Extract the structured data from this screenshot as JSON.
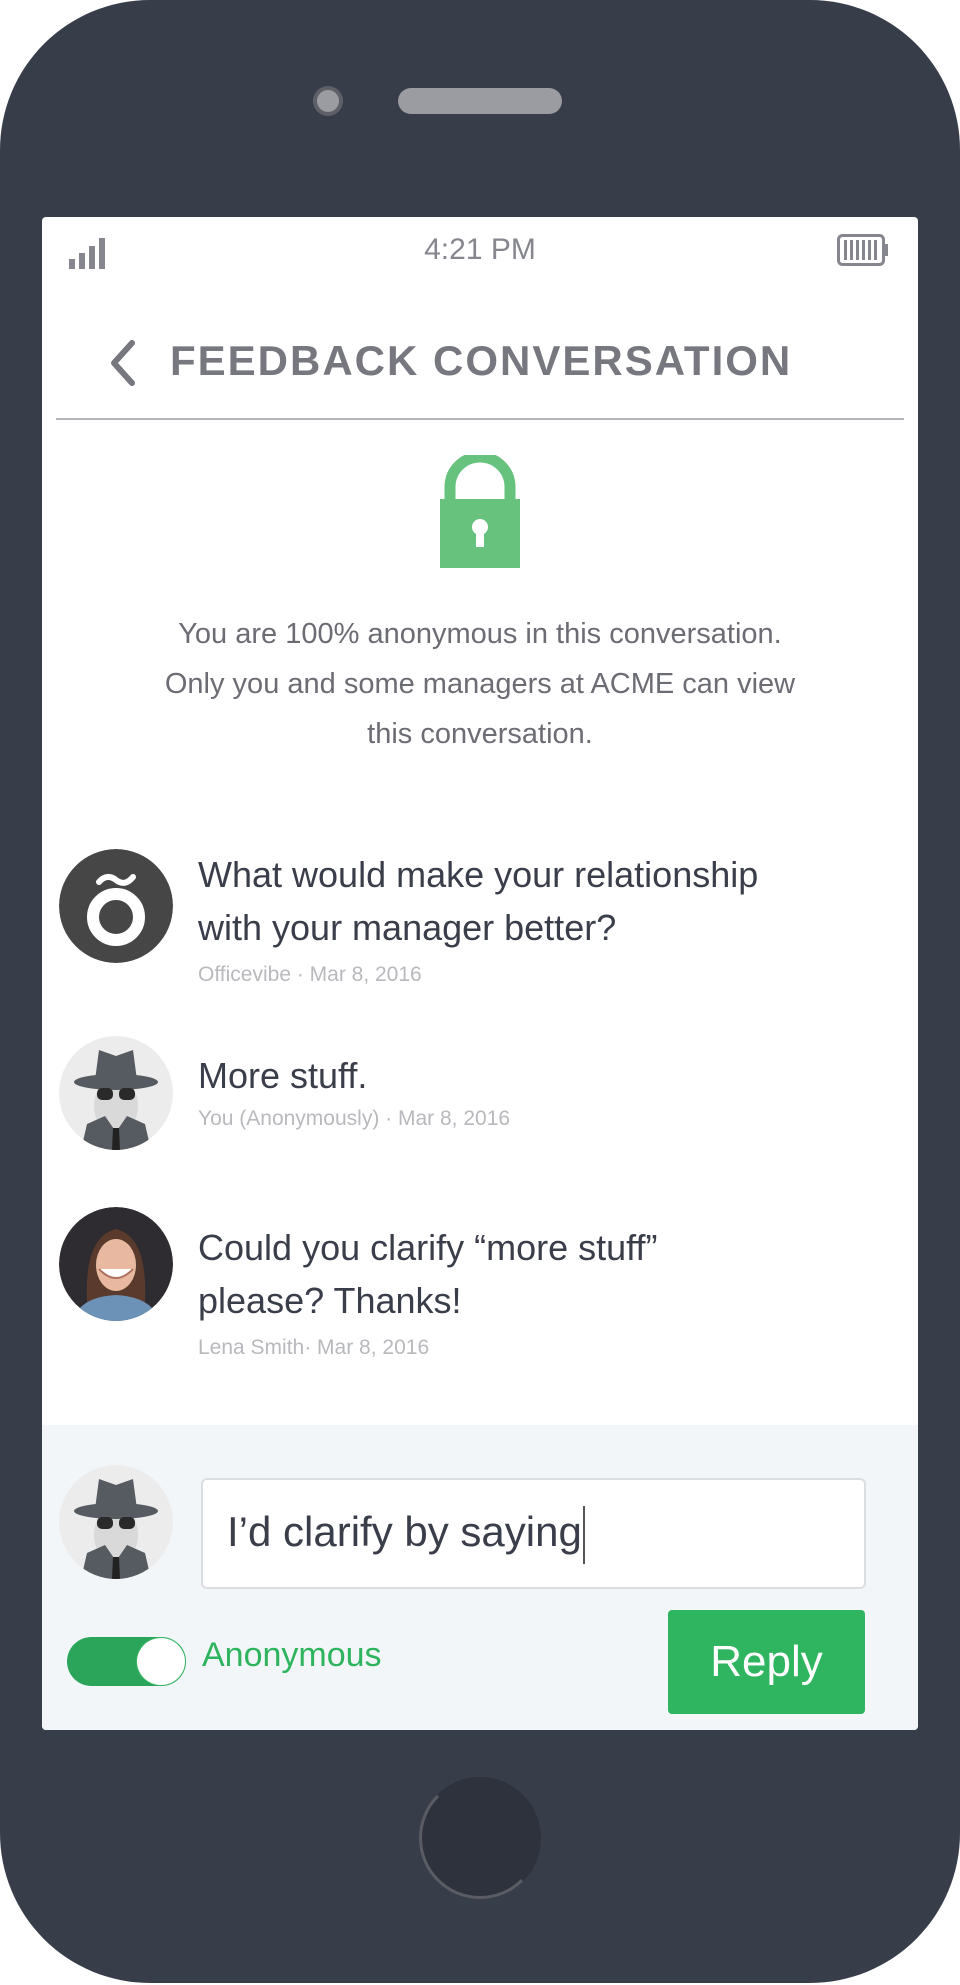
{
  "status_bar": {
    "time": "4:21 PM",
    "signal_icon": "signal-icon",
    "battery_icon": "battery-icon"
  },
  "header": {
    "title": "FEEDBACK CONVERSATION",
    "back_icon": "chevron-left-icon"
  },
  "privacy": {
    "icon": "lock-icon",
    "lines": [
      "You are 100% anonymous in this conversation.",
      "Only you and some managers at ACME can view",
      "this conversation."
    ]
  },
  "messages": [
    {
      "lines": [
        "What would make your relationship",
        "with your manager better?"
      ],
      "meta": "Officevibe · Mar 8, 2016",
      "avatar": "officevibe-logo"
    },
    {
      "lines": [
        "More stuff."
      ],
      "meta": "You (Anonymously) · Mar 8, 2016",
      "avatar": "anonymous-spy"
    },
    {
      "lines": [
        "Could you clarify “more stuff”",
        "please? Thanks!"
      ],
      "meta": "Lena Smith· Mar 8, 2016",
      "avatar": "lena-smith-photo"
    }
  ],
  "composer": {
    "value": "I’d clarify by saying",
    "anonymous_label": "Anonymous",
    "anonymous_on": true,
    "reply_label": "Reply"
  },
  "colors": {
    "accent": "#2fb560",
    "lock": "#66c27c",
    "frame": "#383d4a",
    "footer_bg": "#f3f6f9"
  }
}
